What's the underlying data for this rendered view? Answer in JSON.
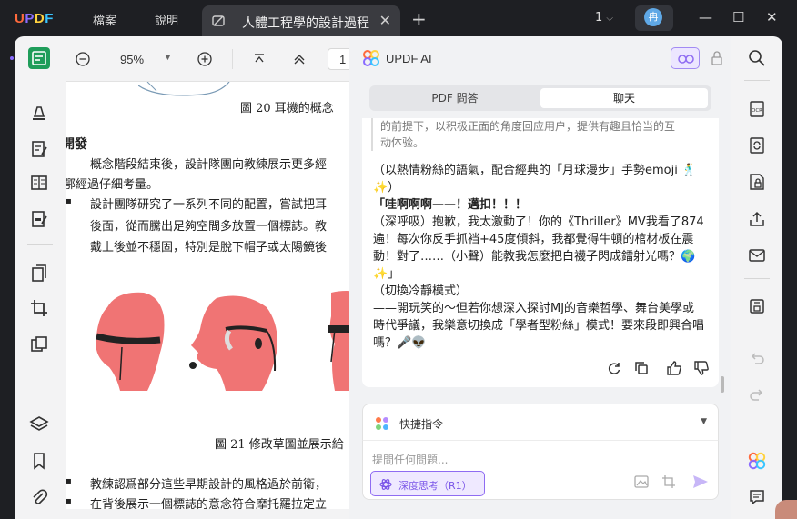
{
  "app": {
    "logo": {
      "u": "U",
      "p": "P",
      "d": "D",
      "f": "F"
    },
    "menu": [
      "檔案",
      "說明"
    ],
    "tab_title": "人體工程學的設計過程",
    "page_indicator": "1",
    "avatar_initial": "冉"
  },
  "doc_toolbar": {
    "zoom": "95%",
    "page_input": "1"
  },
  "document": {
    "caption_top": "圖 20 耳機的概念",
    "section_heading": "開發",
    "para1_line1": "概念階段結束後，設計隊團向教練展示更多經",
    "para1_line2": "鄂經過仔細考量。",
    "bullet1_line1": "設計團隊研究了一系列不同的配置，嘗試把耳",
    "bullet1_line2": "後面，從而騰出足夠空間多放置一個標誌。教",
    "bullet1_line3": "戴上後並不穩固，特別是脫下帽子或太陽鏡後",
    "caption_bottom": "圖 21 修改草圖並展示給",
    "bullet2_line1": "教練認爲部分這些早期設計的風格過於前衛，",
    "bullet2_line2": "在背後展示一個標誌的意念符合摩托羅拉定立"
  },
  "ai": {
    "title": "UPDF AI",
    "tabs": [
      "PDF 問答",
      "聊天"
    ],
    "quote_line1": "的前提下，以积极正面的角度回应用户，提供有趣且恰当的互",
    "quote_line2": "动体验。",
    "msg_line1": "（以熱情粉絲的語氣，配合經典的「月球漫步」手勢emoji 🕺",
    "msg_line2": "✨）",
    "msg_line3": "「哇啊啊啊——！邁扣！！！",
    "msg_line4": "（深呼吸）抱歉，我太激動了！你的《Thriller》MV我看了874",
    "msg_line5": "遍！每次你反手抓裆+45度傾斜，我都覺得牛頓的棺材板在震",
    "msg_line6": "動！對了……（小聲）能教我怎麼把白襪子閃成鐳射光嗎？🌍",
    "msg_line7": "✨」",
    "msg_line8": "（切換冷靜模式）",
    "msg_line9": "——開玩笑的～但若你想深入探討MJ的音樂哲學、舞台美學或",
    "msg_line10": "時代爭議，我樂意切換成「學者型粉絲」模式！要來段即興合唱",
    "msg_line11": "嗎？🎤👽",
    "quick_commands": "快捷指令",
    "input_placeholder": "提問任何問題...",
    "deep_think": "深度思考（R1）"
  },
  "colors": {
    "accent_green": "#1f9d5a",
    "ai_purple": "#8f6cf2",
    "dark_chrome": "#1e1f23",
    "figure_pink": "#f07474"
  },
  "icons": [
    "pencil-icon",
    "edit-icon",
    "book-icon",
    "form-icon",
    "organize-icon",
    "crop-icon",
    "layers-icon",
    "bookmark-icon",
    "paperclip-icon",
    "search-icon",
    "ocr-icon",
    "convert-icon",
    "protect-icon",
    "share-icon",
    "mail-icon",
    "save-icon",
    "undo-icon",
    "redo-icon",
    "updf-ai-icon",
    "comment-icon"
  ]
}
